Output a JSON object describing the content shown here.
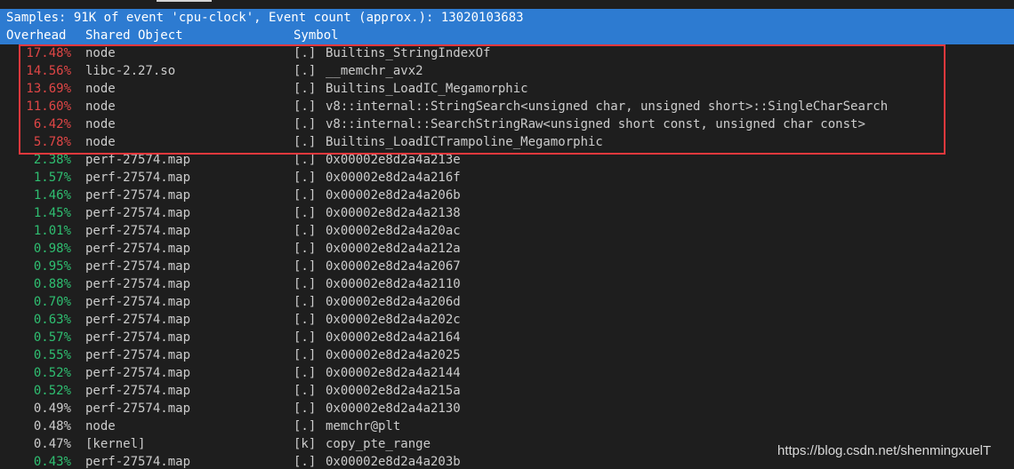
{
  "summary": "Samples: 91K of event 'cpu-clock', Event count (approx.): 13020103683",
  "header": {
    "overhead": "Overhead",
    "shared_object": "Shared Object",
    "symbol": "Symbol"
  },
  "rows": [
    {
      "overhead": "17.48%",
      "object": "node",
      "level": "[.]",
      "symbol": "Builtins_StringIndexOf",
      "color": "red"
    },
    {
      "overhead": "14.56%",
      "object": "libc-2.27.so",
      "level": "[.]",
      "symbol": "__memchr_avx2",
      "color": "red"
    },
    {
      "overhead": "13.69%",
      "object": "node",
      "level": "[.]",
      "symbol": "Builtins_LoadIC_Megamorphic",
      "color": "red"
    },
    {
      "overhead": "11.60%",
      "object": "node",
      "level": "[.]",
      "symbol": "v8::internal::StringSearch<unsigned char, unsigned short>::SingleCharSearch",
      "color": "red"
    },
    {
      "overhead": "6.42%",
      "object": "node",
      "level": "[.]",
      "symbol": "v8::internal::SearchStringRaw<unsigned short const, unsigned char const>",
      "color": "red"
    },
    {
      "overhead": "5.78%",
      "object": "node",
      "level": "[.]",
      "symbol": "Builtins_LoadICTrampoline_Megamorphic",
      "color": "red"
    },
    {
      "overhead": "2.38%",
      "object": "perf-27574.map",
      "level": "[.]",
      "symbol": "0x00002e8d2a4a213e",
      "color": "green"
    },
    {
      "overhead": "1.57%",
      "object": "perf-27574.map",
      "level": "[.]",
      "symbol": "0x00002e8d2a4a216f",
      "color": "green"
    },
    {
      "overhead": "1.46%",
      "object": "perf-27574.map",
      "level": "[.]",
      "symbol": "0x00002e8d2a4a206b",
      "color": "green"
    },
    {
      "overhead": "1.45%",
      "object": "perf-27574.map",
      "level": "[.]",
      "symbol": "0x00002e8d2a4a2138",
      "color": "green"
    },
    {
      "overhead": "1.01%",
      "object": "perf-27574.map",
      "level": "[.]",
      "symbol": "0x00002e8d2a4a20ac",
      "color": "green"
    },
    {
      "overhead": "0.98%",
      "object": "perf-27574.map",
      "level": "[.]",
      "symbol": "0x00002e8d2a4a212a",
      "color": "green"
    },
    {
      "overhead": "0.95%",
      "object": "perf-27574.map",
      "level": "[.]",
      "symbol": "0x00002e8d2a4a2067",
      "color": "green"
    },
    {
      "overhead": "0.88%",
      "object": "perf-27574.map",
      "level": "[.]",
      "symbol": "0x00002e8d2a4a2110",
      "color": "green"
    },
    {
      "overhead": "0.70%",
      "object": "perf-27574.map",
      "level": "[.]",
      "symbol": "0x00002e8d2a4a206d",
      "color": "green"
    },
    {
      "overhead": "0.63%",
      "object": "perf-27574.map",
      "level": "[.]",
      "symbol": "0x00002e8d2a4a202c",
      "color": "green"
    },
    {
      "overhead": "0.57%",
      "object": "perf-27574.map",
      "level": "[.]",
      "symbol": "0x00002e8d2a4a2164",
      "color": "green"
    },
    {
      "overhead": "0.55%",
      "object": "perf-27574.map",
      "level": "[.]",
      "symbol": "0x00002e8d2a4a2025",
      "color": "green"
    },
    {
      "overhead": "0.52%",
      "object": "perf-27574.map",
      "level": "[.]",
      "symbol": "0x00002e8d2a4a2144",
      "color": "green"
    },
    {
      "overhead": "0.52%",
      "object": "perf-27574.map",
      "level": "[.]",
      "symbol": "0x00002e8d2a4a215a",
      "color": "green"
    },
    {
      "overhead": "0.49%",
      "object": "perf-27574.map",
      "level": "[.]",
      "symbol": "0x00002e8d2a4a2130",
      "color": "plain"
    },
    {
      "overhead": "0.48%",
      "object": "node",
      "level": "[.]",
      "symbol": "memchr@plt",
      "color": "plain"
    },
    {
      "overhead": "0.47%",
      "object": "[kernel]",
      "level": "[k]",
      "symbol": "copy_pte_range",
      "color": "plain"
    },
    {
      "overhead": "0.43%",
      "object": "perf-27574.map",
      "level": "[.]",
      "symbol": "0x00002e8d2a4a203b",
      "color": "green"
    }
  ],
  "watermark": "https://blog.csdn.net/shenmingxuelT",
  "colors": {
    "background": "#1e1e1e",
    "header_bg": "#2d7bd1",
    "red": "#e04646",
    "green": "#2fbf71",
    "highlight_box": "#e8383d"
  }
}
